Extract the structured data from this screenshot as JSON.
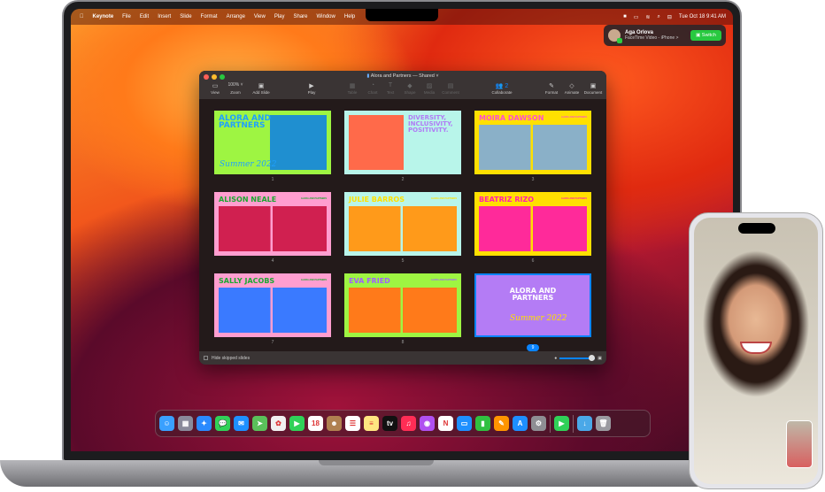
{
  "menubar": {
    "apple": "",
    "app": "Keynote",
    "items": [
      "File",
      "Edit",
      "Insert",
      "Slide",
      "Format",
      "Arrange",
      "View",
      "Play",
      "Share",
      "Window",
      "Help"
    ],
    "datetime": "Tue Oct 18  9:41 AM"
  },
  "notification": {
    "name": "Aga Orlova",
    "subtitle": "FaceTime Video - iPhone >",
    "button": "Switch"
  },
  "window": {
    "title": "Alora and Partners — Shared ˅",
    "zoom": "100% ˅",
    "tools": [
      {
        "label": "View",
        "icon": "▭"
      },
      {
        "label": "Zoom",
        "icon": ""
      },
      {
        "label": "Add Slide",
        "icon": "▣"
      },
      {
        "label": "Play",
        "icon": "▶"
      },
      {
        "label": "Table",
        "icon": "▦"
      },
      {
        "label": "Chart",
        "icon": "◔"
      },
      {
        "label": "Text",
        "icon": "T"
      },
      {
        "label": "Shape",
        "icon": "◆"
      },
      {
        "label": "Media",
        "icon": "▨"
      },
      {
        "label": "Comment",
        "icon": "▤"
      },
      {
        "label": "Collaborate",
        "icon": "👥 2"
      },
      {
        "label": "Format",
        "icon": "✎"
      },
      {
        "label": "Animate",
        "icon": "◇"
      },
      {
        "label": "Document",
        "icon": "▣"
      }
    ],
    "slides": [
      {
        "num": "1",
        "title": "ALORA AND PARTNERS",
        "sub": "Summer 2022",
        "bg": "#9ef542",
        "fg": "#1fa0ff",
        "border": "#9ef542",
        "photo": "#1f8fd0"
      },
      {
        "num": "2",
        "title": "DIVERSITY, INCLUSIVITY, POSITIVITY.",
        "bg": "#b8f5ea",
        "fg": "#b07cf5",
        "border": "#b8f5ea",
        "photo": "#ff6a4a"
      },
      {
        "num": "3",
        "title": "MOIRA DAWSON",
        "tag": "ALORA AND PARTNERS",
        "bg": "#ffe000",
        "fg": "#ff4fd0",
        "border": "#ffe000",
        "photo": "#8ab0c8"
      },
      {
        "num": "4",
        "title": "ALISON NEALE",
        "tag": "ALORA AND PARTNERS",
        "bg": "#ff9ed0",
        "fg": "#1aa830",
        "border": "#ff9ed0",
        "photo": "#d02050"
      },
      {
        "num": "5",
        "title": "JULIE BARROS",
        "tag": "ALORA AND PARTNERS",
        "bg": "#b8f5ea",
        "fg": "#ffe000",
        "border": "#b8f5ea",
        "photo": "#ff9a1a"
      },
      {
        "num": "6",
        "title": "BEATRIZ RIZO",
        "tag": "ALORA AND PARTNERS",
        "bg": "#ffe000",
        "fg": "#ff1fb0",
        "border": "#ffe000",
        "photo": "#ff2a9a"
      },
      {
        "num": "7",
        "title": "SALLY JACOBS",
        "tag": "ALORA AND PARTNERS",
        "bg": "#ff9ed0",
        "fg": "#1aa830",
        "border": "#ff9ed0",
        "photo": "#3a7aff"
      },
      {
        "num": "8",
        "title": "EVA FRIED",
        "tag": "ALORA AND PARTNERS",
        "bg": "#9ef542",
        "fg": "#a060ff",
        "border": "#9ef542",
        "photo": "#ff7a1a"
      },
      {
        "num": "9",
        "title": "ALORA AND PARTNERS",
        "sub": "Summer 2022",
        "bg": "#b47cf5",
        "fg": "#9ef542",
        "border": "#0a84ff",
        "photo": ""
      }
    ],
    "footer": {
      "hide_skipped": "Hide skipped slides",
      "zoom_level": 0.9
    }
  },
  "dock": [
    {
      "name": "finder",
      "c": "#3aa0ff",
      "g": "☺"
    },
    {
      "name": "launchpad",
      "c": "#8a8a9a",
      "g": "▦"
    },
    {
      "name": "safari",
      "c": "#2a8aff",
      "g": "✦"
    },
    {
      "name": "messages",
      "c": "#30d158",
      "g": "💬"
    },
    {
      "name": "mail",
      "c": "#1e90ff",
      "g": "✉"
    },
    {
      "name": "maps",
      "c": "#5ac05a",
      "g": "➤"
    },
    {
      "name": "photos",
      "c": "#f0f0f0",
      "g": "✿"
    },
    {
      "name": "facetime",
      "c": "#30d158",
      "g": "▶"
    },
    {
      "name": "calendar",
      "c": "#ffffff",
      "g": "18"
    },
    {
      "name": "contacts",
      "c": "#b08050",
      "g": "☻"
    },
    {
      "name": "reminders",
      "c": "#ffffff",
      "g": "☰"
    },
    {
      "name": "notes",
      "c": "#ffe680",
      "g": "≡"
    },
    {
      "name": "apple-tv",
      "c": "#111111",
      "g": "tv"
    },
    {
      "name": "music",
      "c": "#ff2d55",
      "g": "♫"
    },
    {
      "name": "podcasts",
      "c": "#b050f0",
      "g": "◉"
    },
    {
      "name": "news",
      "c": "#ffffff",
      "g": "N"
    },
    {
      "name": "keynote",
      "c": "#1e90ff",
      "g": "▭"
    },
    {
      "name": "numbers",
      "c": "#30c040",
      "g": "▮"
    },
    {
      "name": "pages",
      "c": "#ff9500",
      "g": "✎"
    },
    {
      "name": "app-store",
      "c": "#1e8fff",
      "g": "A"
    },
    {
      "name": "system-settings",
      "c": "#8e8e93",
      "g": "⚙"
    },
    {
      "name": "facetime-handoff",
      "c": "#30d158",
      "g": "▶"
    },
    {
      "name": "downloads",
      "c": "#4aa8e8",
      "g": "↓"
    },
    {
      "name": "trash",
      "c": "#9a9aa0",
      "g": "🗑"
    }
  ],
  "dock_badge": "📱"
}
